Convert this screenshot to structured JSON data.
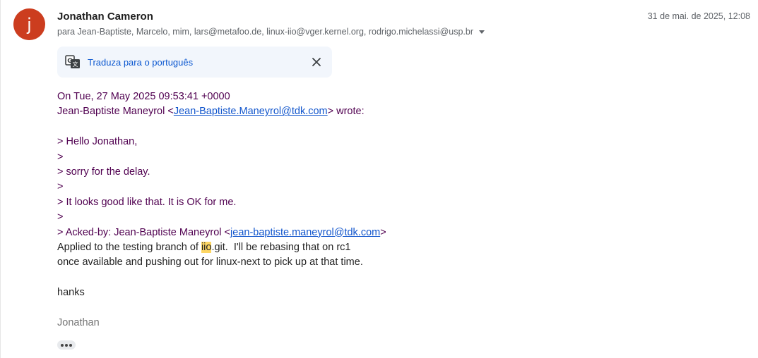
{
  "message": {
    "sender_name": "Jonathan Cameron",
    "avatar_letter": "j",
    "date": "31 de mai. de 2025, 12:08",
    "recipients": "para Jean-Baptiste, Marcelo, mim, lars@metafoo.de, linux-iio@vger.kernel.org, rodrigo.michelassi@usp.br"
  },
  "translate": {
    "label": "Traduza para o português"
  },
  "body": {
    "header_line1": "On Tue, 27 May 2025 09:53:41 +0000",
    "header_line2_prefix": "Jean-Baptiste Maneyrol <",
    "header_line2_link": "Jean-Baptiste.Maneyrol@tdk.com",
    "header_line2_suffix": "> wrote:",
    "quote_lines": [
      "> Hello Jonathan,",
      ">",
      "> sorry for the delay.",
      ">",
      "> It looks good like that. It is OK for me.",
      ">"
    ],
    "acked_prefix": "> Acked-by: Jean-Baptiste Maneyrol <",
    "acked_link": "jean-baptiste.maneyrol@tdk.com",
    "acked_suffix": ">",
    "applied_prefix": "Applied to the testing branch of ",
    "applied_highlight": "iio",
    "applied_suffix": ".git.  I'll be rebasing that on rc1",
    "line_available": "once available and pushing out for linux-next to pick up at that time.",
    "thanks": "hanks",
    "signature": "Jonathan"
  },
  "colors": {
    "avatar_bg": "#cc3d1f",
    "quote_text": "#500050",
    "link": "#1155cc",
    "translate_link": "#0b57d0",
    "highlight": "#fdd663"
  }
}
